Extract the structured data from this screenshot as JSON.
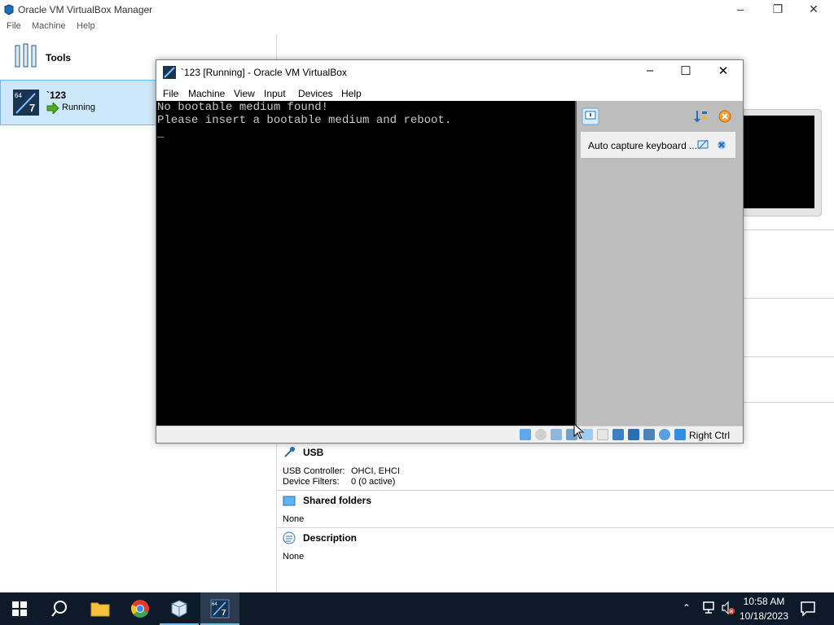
{
  "manager": {
    "title": "Oracle VM VirtualBox Manager",
    "menu": [
      "File",
      "Machine",
      "Help"
    ],
    "tools_label": "Tools",
    "vm": {
      "name": "`123",
      "state": "Running"
    }
  },
  "details": {
    "usb": {
      "title": "USB",
      "controller_label": "USB Controller:",
      "controller_value": "OHCI, EHCI",
      "filters_label": "Device Filters:",
      "filters_value": "0 (0 active)"
    },
    "shared_folders": {
      "title": "Shared folders",
      "value": "None"
    },
    "description": {
      "title": "Description",
      "value": "None"
    }
  },
  "vm_window": {
    "title": "`123 [Running] - Oracle VM VirtualBox",
    "menu": [
      "File",
      "Machine",
      "View",
      "Input",
      "Devices",
      "Help"
    ],
    "console_lines": [
      "No bootable medium found!",
      "Please insert a bootable medium and reboot."
    ],
    "cursor": "_",
    "notification": "Auto capture keyboard ...",
    "host_key": "Right Ctrl"
  },
  "taskbar": {
    "time": "10:58 AM",
    "date": "10/18/2023"
  },
  "colors": {
    "selection": "#cde7fb",
    "accent_green": "#4caf1f",
    "taskbar": "#0d1a2a"
  }
}
